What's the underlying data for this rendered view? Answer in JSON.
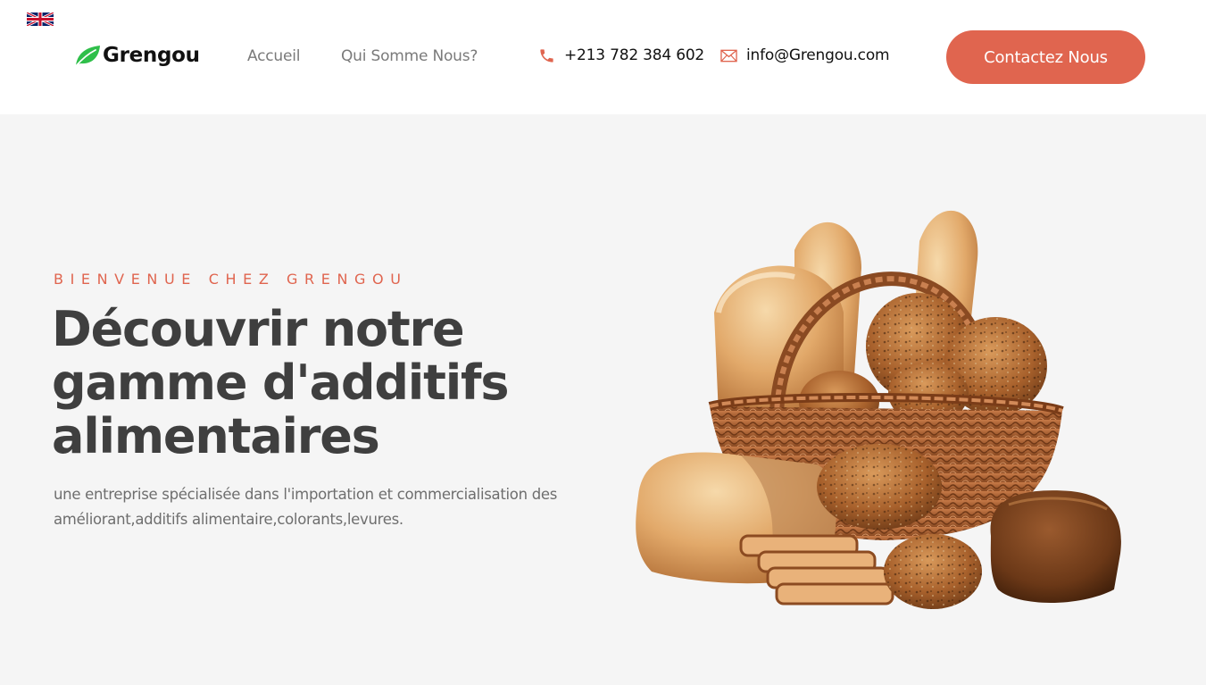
{
  "header": {
    "language": "English",
    "logo_text": "Grengou",
    "nav": {
      "home": "Accueil",
      "about": "Qui Somme Nous?"
    },
    "phone": "+213 782 384 602",
    "email": "info@Grengou.com",
    "cta_label": "Contactez Nous"
  },
  "hero": {
    "eyebrow": "BIENVENUE CHEZ GRENGOU",
    "headline": "Découvrir notre gamme d'additifs alimentaires",
    "lead": "une entreprise spécialisée dans l'importation et commercialisation des améliorant,additifs alimentaire,colorants,levures.",
    "image": "bread-basket"
  },
  "icons": {
    "logo": "leaf-icon",
    "phone": "phone-icon",
    "email": "mail-icon",
    "language": "uk-flag-icon"
  },
  "colors": {
    "accent": "#e0654f",
    "brand_leaf": "#2fbf4a",
    "heading": "#3f3f3f",
    "body_text": "#6e6e6e",
    "nav_text": "#7a7a7a",
    "hero_bg": "#f5f5f5"
  }
}
